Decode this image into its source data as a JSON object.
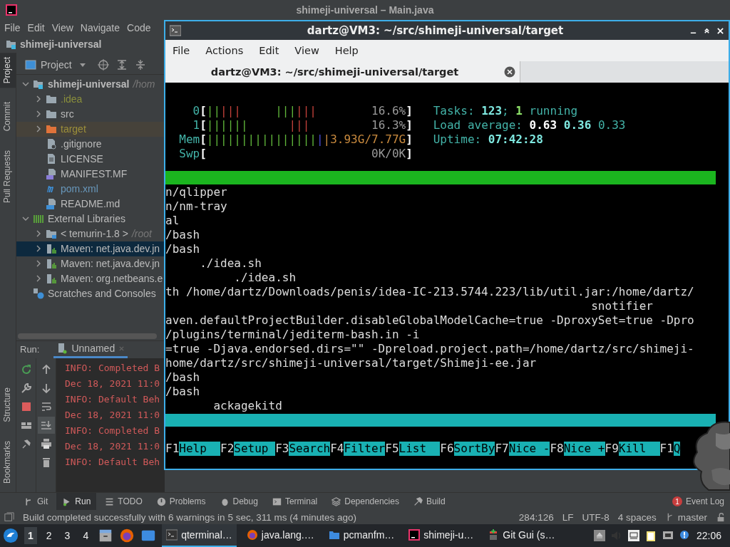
{
  "ide": {
    "title": "shimeji-universal – Main.java",
    "menu": [
      "File",
      "Edit",
      "View",
      "Navigate",
      "Code"
    ],
    "breadcrumb": "shimeji-universal",
    "side_tabs_top": [
      {
        "label": "Project",
        "selected": true
      },
      {
        "label": "Commit",
        "selected": false
      },
      {
        "label": "Pull Requests",
        "selected": false
      }
    ],
    "side_tabs_bottom": [
      {
        "label": "Structure",
        "selected": false
      },
      {
        "label": "Bookmarks",
        "selected": false
      }
    ],
    "project_panel": {
      "view": "Project",
      "tree": [
        {
          "label": "shimeji-universal",
          "hint": "/hom",
          "kind": "module",
          "expanded": true,
          "selected": false,
          "color": "#bbbbbb",
          "children": [
            {
              "label": ".idea",
              "kind": "folder",
              "expanded": false,
              "selected": false,
              "color": "#8a8f3c"
            },
            {
              "label": "src",
              "kind": "folder",
              "expanded": false,
              "selected": false,
              "color": "#bbbbbb"
            },
            {
              "label": "target",
              "kind": "excluded-folder",
              "expanded": false,
              "selected": false,
              "color": "#9c8f3a"
            },
            {
              "label": ".gitignore",
              "kind": "ignore-file",
              "selected": false,
              "color": "#bbbbbb"
            },
            {
              "label": "LICENSE",
              "kind": "text-file",
              "selected": false,
              "color": "#bbbbbb"
            },
            {
              "label": "MANIFEST.MF",
              "kind": "manifest-file",
              "selected": false,
              "color": "#bbbbbb"
            },
            {
              "label": "pom.xml",
              "kind": "maven-file",
              "selected": false,
              "color": "#6897bb"
            },
            {
              "label": "README.md",
              "kind": "markdown-file",
              "selected": false,
              "color": "#bbbbbb"
            }
          ]
        },
        {
          "label": "External Libraries",
          "kind": "libraries",
          "expanded": true,
          "selected": false,
          "color": "#bbbbbb",
          "children": [
            {
              "label": "< temurin-1.8 >",
              "hint": "/root",
              "kind": "sdk",
              "expanded": false,
              "selected": false,
              "color": "#bbbbbb"
            },
            {
              "label": "Maven: net.java.dev.jn",
              "kind": "library",
              "expanded": false,
              "selected": true,
              "color": "#bbbbbb"
            },
            {
              "label": "Maven: net.java.dev.jn",
              "kind": "library",
              "expanded": false,
              "selected": false,
              "color": "#bbbbbb"
            },
            {
              "label": "Maven: org.netbeans.e",
              "kind": "library",
              "expanded": false,
              "selected": false,
              "color": "#bbbbbb"
            }
          ]
        },
        {
          "label": "Scratches and Consoles",
          "kind": "scratches",
          "selected": false,
          "color": "#bbbbbb"
        }
      ]
    },
    "run_panel": {
      "label": "Run:",
      "tab": "Unnamed",
      "lines": [
        "INFO: Completed B",
        "Dec 18, 2021 11:0",
        "INFO: Default Beh",
        "Dec 18, 2021 11:0",
        "INFO: Completed B",
        "Dec 18, 2021 11:0",
        "INFO: Default Beh"
      ]
    },
    "tool_tabs": [
      {
        "label": "Git",
        "selected": false
      },
      {
        "label": "Run",
        "selected": true
      },
      {
        "label": "TODO",
        "selected": false
      },
      {
        "label": "Problems",
        "selected": false
      },
      {
        "label": "Debug",
        "selected": false
      },
      {
        "label": "Terminal",
        "selected": false
      },
      {
        "label": "Dependencies",
        "selected": false
      },
      {
        "label": "Build",
        "selected": false
      }
    ],
    "event_log": {
      "label": "Event Log",
      "badge": "1"
    },
    "status": {
      "message": "Build completed successfully with 6 warnings in 5 sec, 311 ms (4 minutes ago)",
      "position": "284:126",
      "line_separator": "LF",
      "encoding": "UTF-8",
      "indent": "4 spaces",
      "branch": "master"
    }
  },
  "terminal": {
    "title": "dartz@VM3: ~/src/shimeji-universal/target",
    "menu": [
      "File",
      "Actions",
      "Edit",
      "View",
      "Help"
    ],
    "tab": "dartz@VM3: ~/src/shimeji-universal/target",
    "meters": [
      {
        "label": "0",
        "kind": "cpu",
        "open": "[",
        "close": "]",
        "segments": [
          {
            "kind": "user",
            "text": "||"
          },
          {
            "kind": "kernel",
            "text": "|||     "
          },
          {
            "kind": "user",
            "text": "|||"
          },
          {
            "kind": "kernel",
            "text": "|||"
          }
        ],
        "reading": "16.6%"
      },
      {
        "label": "1",
        "kind": "cpu",
        "open": "[",
        "close": "]",
        "segments": [
          {
            "kind": "user",
            "text": "||||||      "
          },
          {
            "kind": "kernel",
            "text": "|||"
          }
        ],
        "reading": "16.3%"
      },
      {
        "label": "Mem",
        "kind": "memory",
        "open": "[",
        "close": "]",
        "segments": [
          {
            "kind": "user",
            "text": "||||||||||||||||"
          },
          {
            "kind": "buffers",
            "text": "|"
          },
          {
            "kind": "cache",
            "text": "|"
          }
        ],
        "reading": "3.93G/7.77G"
      },
      {
        "label": "Swp",
        "kind": "swap",
        "open": "[",
        "close": "]",
        "reading": "0K/0K"
      }
    ],
    "info": [
      [
        {
          "kind": "label",
          "text": "Tasks: "
        },
        {
          "kind": "value",
          "text": "123"
        },
        {
          "kind": "label",
          "text": "; "
        },
        {
          "kind": "running",
          "text": "1"
        },
        {
          "kind": "label",
          "text": " running"
        }
      ],
      [
        {
          "kind": "label",
          "text": "Load average: "
        },
        {
          "kind": "load",
          "text": "0.63"
        },
        {
          "kind": "value",
          "text": " 0.36"
        },
        {
          "kind": "plain",
          "text": " 0.33"
        }
      ],
      [
        {
          "kind": "label",
          "text": "Uptime: "
        },
        {
          "kind": "value",
          "text": "07:42:28"
        }
      ]
    ],
    "processes": [
      {
        "text": "n/qlipper",
        "selected": false
      },
      {
        "text": "n/nm-tray",
        "selected": false
      },
      {
        "text": "al",
        "selected": false
      },
      {
        "text": "/bash",
        "selected": false
      },
      {
        "text": "/bash",
        "selected": false
      },
      {
        "text": "     ./idea.sh",
        "selected": false
      },
      {
        "text": "          ./idea.sh",
        "selected": false
      },
      {
        "text": "th /home/dartz/Downloads/penis/idea-IC-213.5744.223/lib/util.jar:/home/dartz/",
        "selected": false
      },
      {
        "text": "                                                              snotifier",
        "selected": false
      },
      {
        "text": "aven.defaultProjectBuilder.disableGlobalModelCache=true -DproxySet=true -Dpro",
        "selected": false
      },
      {
        "text": "/plugins/terminal/jediterm-bash.in -i",
        "selected": false
      },
      {
        "text": "=true -Djava.endorsed.dirs=\"\" -Dpreload.project.path=/home/dartz/src/shimeji-",
        "selected": false
      },
      {
        "text": "home/dartz/src/shimeji-universal/target/Shimeji-ee.jar",
        "selected": false
      },
      {
        "text": "/bash",
        "selected": false
      },
      {
        "text": "/bash",
        "selected": false
      },
      {
        "text": "       ackagekitd",
        "selected": false
      }
    ],
    "function_keys": [
      {
        "key": "F1",
        "label": "Help"
      },
      {
        "key": "F2",
        "label": "Setup"
      },
      {
        "key": "F3",
        "label": "Search"
      },
      {
        "key": "F4",
        "label": "Filter"
      },
      {
        "key": "F5",
        "label": "List"
      },
      {
        "key": "F6",
        "label": "SortBy"
      },
      {
        "key": "F7",
        "label": "Nice -"
      },
      {
        "key": "F8",
        "label": "Nice +"
      },
      {
        "key": "F9",
        "label": "Kill"
      },
      {
        "key": "F1",
        "label": "Q"
      }
    ]
  },
  "taskbar": {
    "workspaces": [
      {
        "label": "1",
        "selected": true
      },
      {
        "label": "2",
        "selected": false
      },
      {
        "label": "3",
        "selected": false
      },
      {
        "label": "4",
        "selected": false
      }
    ],
    "tasks": [
      {
        "label": "qterminal…",
        "selected": true
      },
      {
        "label": "java.lang.…",
        "selected": false
      },
      {
        "label": "pcmanfm…",
        "selected": false
      },
      {
        "label": "shimeji-u…",
        "selected": false
      },
      {
        "label": "Git Gui (s…",
        "selected": false
      }
    ],
    "clock": "22:06"
  }
}
